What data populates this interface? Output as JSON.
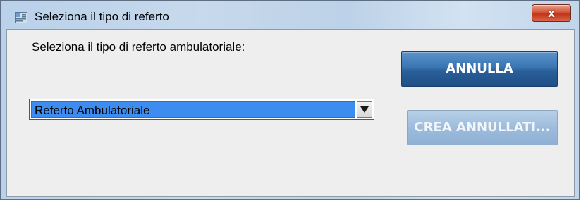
{
  "window": {
    "title": "Seleziona il tipo di referto",
    "close_label": "x"
  },
  "dialog": {
    "prompt": "Seleziona il tipo di referto ambulatoriale:",
    "select": {
      "selected_value": "Referto Ambulatoriale"
    },
    "buttons": {
      "cancel_label": "ANNULLA",
      "create_label": "CREA ANNULLATI..."
    }
  },
  "colors": {
    "selection_highlight": "#3d8df0",
    "primary_button": "#2a5f99",
    "disabled_button": "#9dbcdc",
    "close_button": "#c23418"
  }
}
